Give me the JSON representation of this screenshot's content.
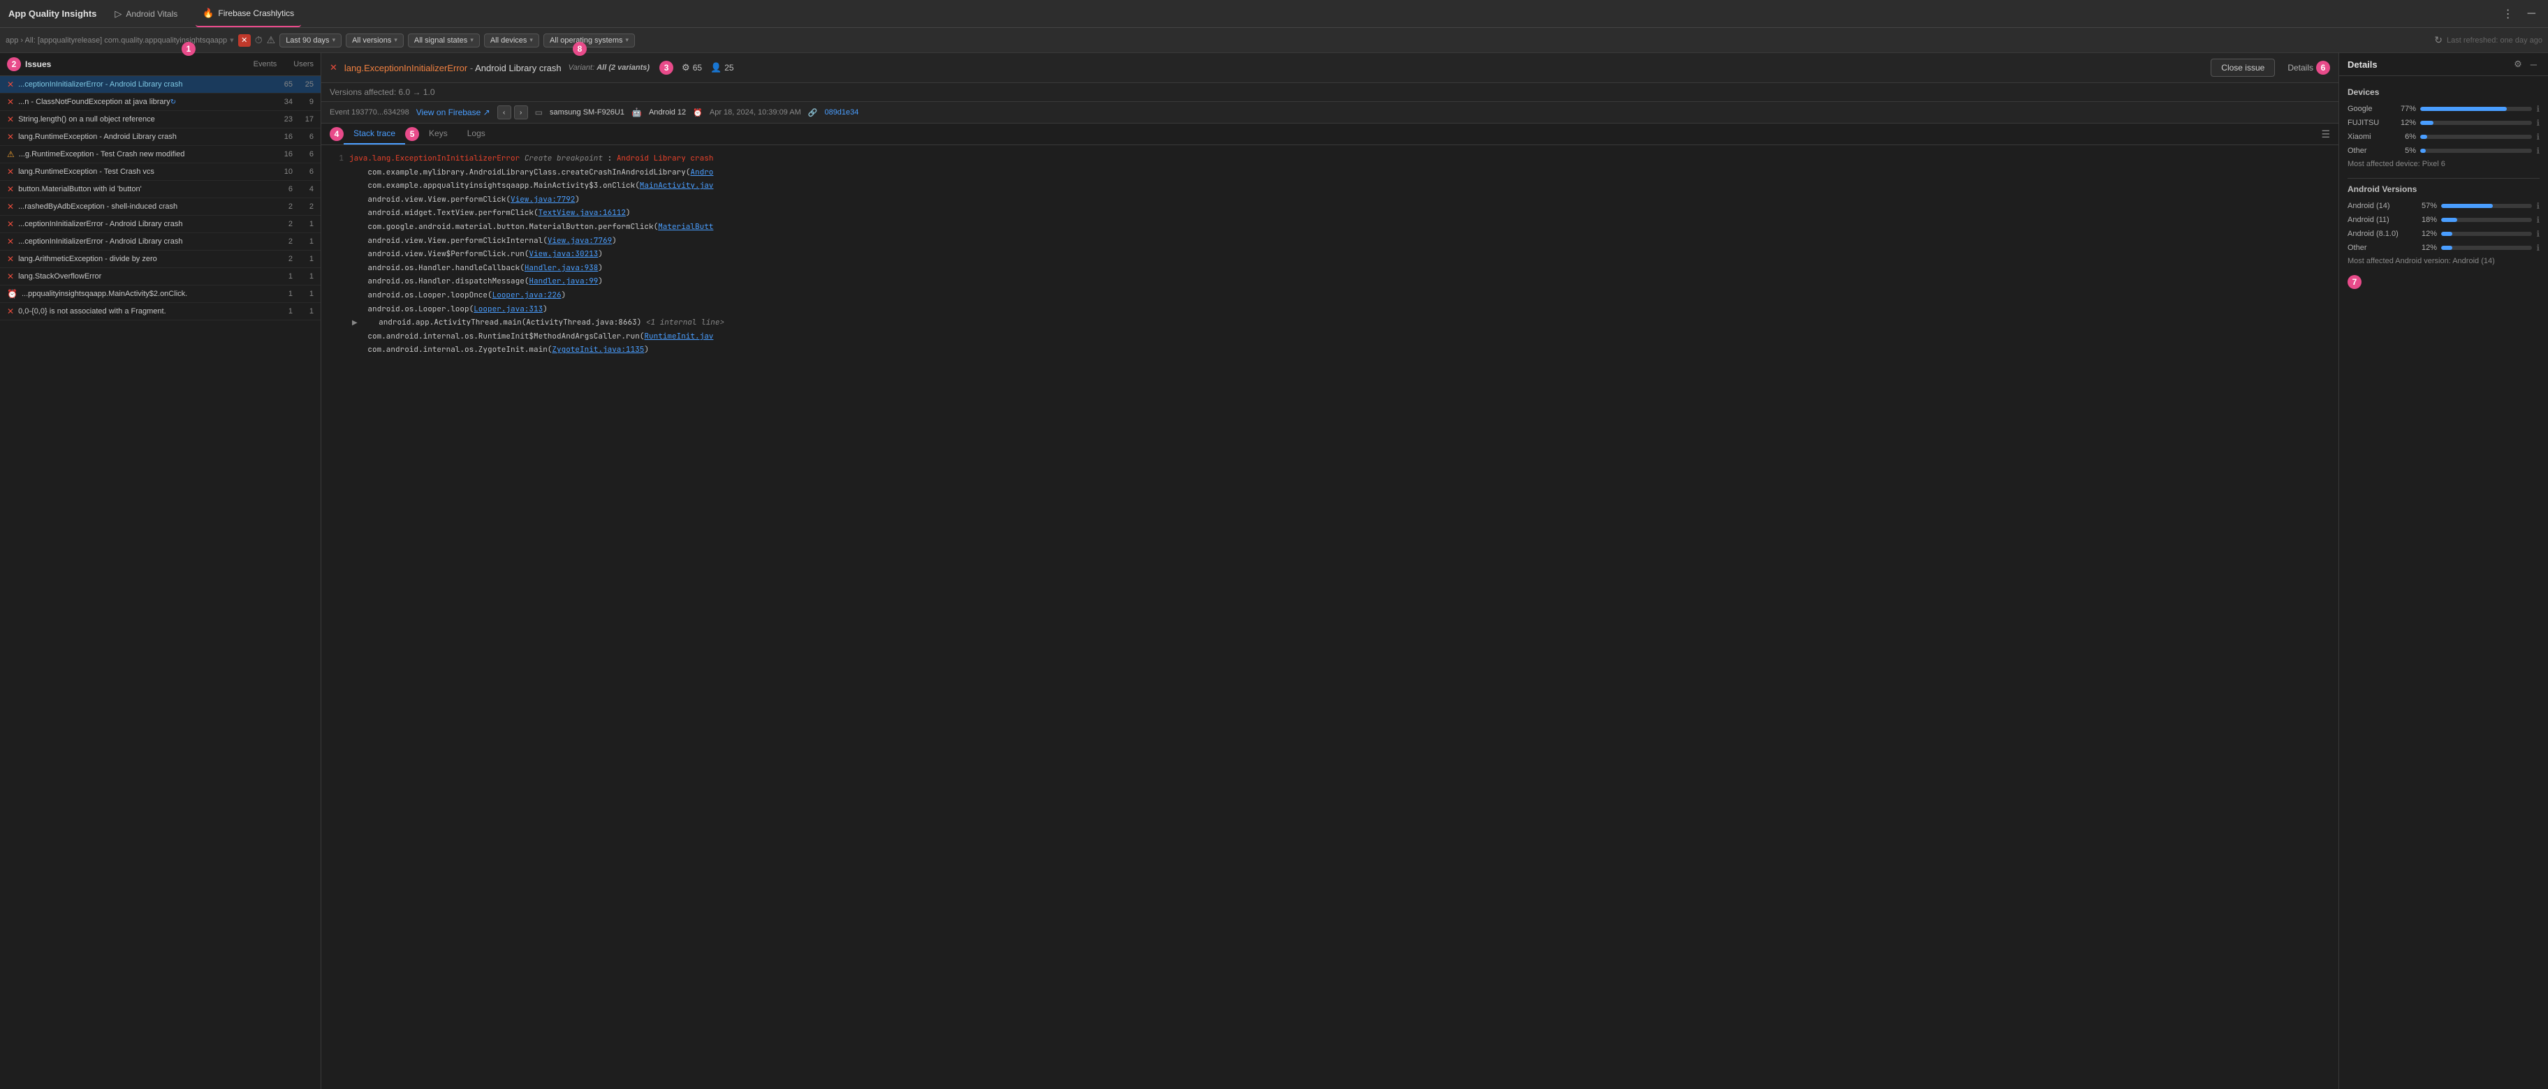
{
  "topbar": {
    "app_title": "App Quality Insights",
    "tabs": [
      {
        "id": "android-vitals",
        "label": "Android Vitals",
        "icon": "▷",
        "active": false
      },
      {
        "id": "firebase",
        "label": "Firebase Crashlytics",
        "icon": "🔥",
        "active": true
      }
    ],
    "menu_icon": "⋮",
    "minimize_icon": "─"
  },
  "filterbar": {
    "breadcrumb": "app › All: [appqualityrelease] com.quality.appqualityinsightsqaapp",
    "filters": [
      {
        "id": "time",
        "label": "Last 90 days",
        "icon": "⏱"
      },
      {
        "id": "versions",
        "label": "All versions"
      },
      {
        "id": "signal",
        "label": "All signal states"
      },
      {
        "id": "devices",
        "label": "All devices"
      },
      {
        "id": "os",
        "label": "All operating systems"
      }
    ],
    "refresh_icon": "↻",
    "last_refreshed": "Last refreshed: one day ago"
  },
  "issues_panel": {
    "title": "Issues",
    "badge_num": "2",
    "col_events": "Events",
    "col_users": "Users",
    "issues": [
      {
        "id": 1,
        "icon": "error",
        "text": "...ceptionInInitializerError - Android Library crash",
        "events": 65,
        "users": 25,
        "selected": true,
        "sync": false
      },
      {
        "id": 2,
        "icon": "error",
        "text": "...n - ClassNotFoundException at java library",
        "events": 34,
        "users": 9,
        "selected": false,
        "sync": true
      },
      {
        "id": 3,
        "icon": "error",
        "text": "String.length() on a null object reference",
        "events": 23,
        "users": 17,
        "selected": false,
        "sync": false
      },
      {
        "id": 4,
        "icon": "error",
        "text": "lang.RuntimeException - Android Library crash",
        "events": 16,
        "users": 6,
        "selected": false,
        "sync": false
      },
      {
        "id": 5,
        "icon": "warning",
        "text": "...g.RuntimeException - Test Crash new modified",
        "events": 16,
        "users": 6,
        "selected": false,
        "sync": false
      },
      {
        "id": 6,
        "icon": "error",
        "text": "lang.RuntimeException - Test Crash vcs",
        "events": 10,
        "users": 6,
        "selected": false,
        "sync": false
      },
      {
        "id": 7,
        "icon": "error",
        "text": "button.MaterialButton with id 'button'",
        "events": 6,
        "users": 4,
        "selected": false,
        "sync": false
      },
      {
        "id": 8,
        "icon": "error",
        "text": "...rashedByAdbException - shell-induced crash",
        "events": 2,
        "users": 2,
        "selected": false,
        "sync": false
      },
      {
        "id": 9,
        "icon": "error",
        "text": "...ceptionInInitializerError - Android Library crash",
        "events": 2,
        "users": 1,
        "selected": false,
        "sync": false
      },
      {
        "id": 10,
        "icon": "error",
        "text": "...ceptionInInitializerError - Android Library crash",
        "events": 2,
        "users": 1,
        "selected": false,
        "sync": false
      },
      {
        "id": 11,
        "icon": "error",
        "text": "lang.ArithmeticException - divide by zero",
        "events": 2,
        "users": 1,
        "selected": false,
        "sync": false
      },
      {
        "id": 12,
        "icon": "error",
        "text": "lang.StackOverflowError",
        "events": 1,
        "users": 1,
        "selected": false,
        "sync": false
      },
      {
        "id": 13,
        "icon": "clock",
        "text": "...ppqualityinsightsqaapp.MainActivity$2.onClick.",
        "events": 1,
        "users": 1,
        "selected": false,
        "sync": false
      },
      {
        "id": 14,
        "icon": "error",
        "text": "0,0-{0,0} is not associated with a Fragment.",
        "events": 1,
        "users": 1,
        "selected": false,
        "sync": false
      }
    ]
  },
  "detail_panel": {
    "crash_exception": "lang.ExceptionInInitializerError",
    "crash_dash": " - ",
    "crash_description": "Android Library crash",
    "variant_label": "Variant:",
    "variant_value": "All (2 variants)",
    "stats_icon": "⚙",
    "events_count": 65,
    "users_icon": "👤",
    "users_count": 25,
    "close_issue_label": "Close issue",
    "details_label": "Details",
    "versions_affected": "Versions affected: 6.0 → 1.0",
    "event_id": "Event 193770...634298",
    "view_firebase_label": "View on Firebase ↗",
    "device_icon": "▭",
    "device_name": "samsung SM-F926U1",
    "android_ver": "Android 12",
    "time": "Apr 18, 2024, 10:39:09 AM",
    "hash": "089d1e34",
    "tabs": [
      "Stack trace",
      "Keys",
      "Logs"
    ],
    "active_tab": "Stack trace",
    "stack_lines": [
      {
        "num": 1,
        "content": "java.lang.ExceptionInInitializerError Create breakpoint : Android Library crash",
        "type": "exception-line"
      },
      {
        "num": null,
        "content": "    com.example.mylibrary.AndroidLibraryClass.createCrashInAndroidLibrary(Andro",
        "type": "link-line",
        "link_part": "Andro"
      },
      {
        "num": null,
        "content": "    com.example.appqualityinsightsqaapp.MainActivity$3.onClick(MainActivity.jav",
        "type": "link-line",
        "link_part": "MainActivity.jav"
      },
      {
        "num": null,
        "content": "    android.view.View.performClick(View.java:7792)",
        "type": "link-line"
      },
      {
        "num": null,
        "content": "    android.widget.TextView.performClick(TextView.java:16112)",
        "type": "link-line"
      },
      {
        "num": null,
        "content": "    com.google.android.material.button.MaterialButton.performClick(MaterialButt",
        "type": "link-line"
      },
      {
        "num": null,
        "content": "    android.view.View.performClickInternal(View.java:7769)",
        "type": "link-line"
      },
      {
        "num": null,
        "content": "    android.view.View$PerformClick.run(View.java:30213)",
        "type": "link-line"
      },
      {
        "num": null,
        "content": "    android.os.Handler.handleCallback(Handler.java:938)",
        "type": "link-line"
      },
      {
        "num": null,
        "content": "    android.os.Handler.dispatchMessage(Handler.java:99)",
        "type": "link-line"
      },
      {
        "num": null,
        "content": "    android.os.Looper.loopOnce(Looper.java:226)",
        "type": "link-line"
      },
      {
        "num": null,
        "content": "    android.os.Looper.loop(Looper.java:313)",
        "type": "link-line"
      },
      {
        "num": null,
        "content": "    android.app.ActivityThread.main(ActivityThread.java:8663) <1 internal line>",
        "type": "internal-line"
      },
      {
        "num": null,
        "content": "    com.android.internal.os.RuntimeInit$MethodAndArgsCaller.run(RuntimeInit.jav",
        "type": "link-line"
      },
      {
        "num": null,
        "content": "    com.android.internal.os.ZygoteInit.main(ZygoteInit.java:1135)",
        "type": "link-line"
      }
    ]
  },
  "right_panel": {
    "title": "Details",
    "devices_section": "Devices",
    "devices": [
      {
        "name": "Google",
        "pct": 77,
        "pct_label": "77%"
      },
      {
        "name": "FUJITSU",
        "pct": 12,
        "pct_label": "12%"
      },
      {
        "name": "Xiaomi",
        "pct": 6,
        "pct_label": "6%"
      },
      {
        "name": "Other",
        "pct": 5,
        "pct_label": "5%"
      }
    ],
    "most_affected_device": "Most affected device: Pixel 6",
    "android_versions_section": "Android Versions",
    "android_versions": [
      {
        "name": "Android (14)",
        "pct": 57,
        "pct_label": "57%"
      },
      {
        "name": "Android (11)",
        "pct": 18,
        "pct_label": "18%"
      },
      {
        "name": "Android (8.1.0)",
        "pct": 12,
        "pct_label": "12%"
      },
      {
        "name": "Other",
        "pct": 12,
        "pct_label": "12%"
      }
    ],
    "most_affected_android": "Most affected Android version: Android (14)"
  },
  "annotations": {
    "num1": "1",
    "num2": "2",
    "num3": "3",
    "num4": "4",
    "num5": "5",
    "num6": "6",
    "num7": "7",
    "num8": "8"
  }
}
